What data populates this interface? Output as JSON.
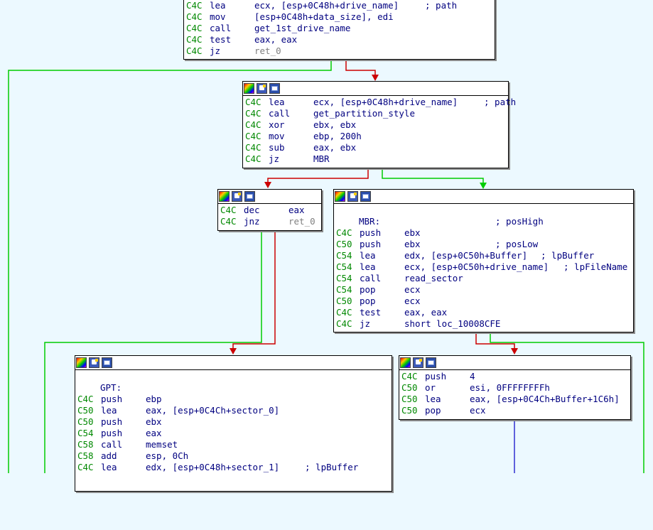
{
  "nodes": {
    "top": {
      "lines": [
        {
          "addr": "C4C",
          "mn": "lea",
          "op": "ecx, [esp+0C48h+drive_name]",
          "cm": "; path"
        },
        {
          "addr": "C4C",
          "mn": "mov",
          "op": "[esp+0C48h+data_size], edi",
          "cm": ""
        },
        {
          "addr": "C4C",
          "mn": "call",
          "op": "get_1st_drive_name",
          "cm": ""
        },
        {
          "addr": "C4C",
          "mn": "test",
          "op": "eax, eax",
          "cm": ""
        },
        {
          "addr": "C4C",
          "mn": "jz",
          "op": "ret_0",
          "cm": ""
        }
      ]
    },
    "partition": {
      "lines": [
        {
          "addr": "C4C",
          "mn": "lea",
          "op": "ecx, [esp+0C48h+drive_name]",
          "cm": "; path"
        },
        {
          "addr": "C4C",
          "mn": "call",
          "op": "get_partition_style",
          "cm": ""
        },
        {
          "addr": "C4C",
          "mn": "xor",
          "op": "ebx, ebx",
          "cm": ""
        },
        {
          "addr": "C4C",
          "mn": "mov",
          "op": "ebp, 200h",
          "cm": ""
        },
        {
          "addr": "C4C",
          "mn": "sub",
          "op": "eax, ebx",
          "cm": ""
        },
        {
          "addr": "C4C",
          "mn": "jz",
          "op": "MBR",
          "cm": ""
        }
      ]
    },
    "dec": {
      "lines": [
        {
          "addr": "C4C",
          "mn": "dec",
          "op": "eax"
        },
        {
          "addr": "C4C",
          "mn": "jnz",
          "op": "ret_0"
        }
      ]
    },
    "mbr": {
      "label": "MBR:",
      "label_comment": "; posHigh",
      "lines": [
        {
          "addr": "C4C",
          "mn": "push",
          "op": "ebx",
          "cm": ""
        },
        {
          "addr": "C50",
          "mn": "push",
          "op": "ebx",
          "cm": "; posLow"
        },
        {
          "addr": "C54",
          "mn": "lea",
          "op": "edx, [esp+0C50h+Buffer]",
          "cm": "; lpBuffer"
        },
        {
          "addr": "C54",
          "mn": "lea",
          "op": "ecx, [esp+0C50h+drive_name]",
          "cm": "; lpFileName"
        },
        {
          "addr": "C54",
          "mn": "call",
          "op": "read_sector",
          "cm": ""
        },
        {
          "addr": "C54",
          "mn": "pop",
          "op": "ecx",
          "cm": ""
        },
        {
          "addr": "C50",
          "mn": "pop",
          "op": "ecx",
          "cm": ""
        },
        {
          "addr": "C4C",
          "mn": "test",
          "op": "eax, eax",
          "cm": ""
        },
        {
          "addr": "C4C",
          "mn": "jz",
          "op": "short loc_10008CFE",
          "cm": ""
        }
      ]
    },
    "gpt": {
      "label": "GPT:",
      "lines": [
        {
          "addr": "C4C",
          "mn": "push",
          "op": "ebp",
          "cm": ""
        },
        {
          "addr": "C50",
          "mn": "lea",
          "op": "eax, [esp+0C4Ch+sector_0]",
          "cm": ""
        },
        {
          "addr": "C50",
          "mn": "push",
          "op": "ebx",
          "cm": ""
        },
        {
          "addr": "C54",
          "mn": "push",
          "op": "eax",
          "cm": ""
        },
        {
          "addr": "C58",
          "mn": "call",
          "op": "memset",
          "cm": ""
        },
        {
          "addr": "C58",
          "mn": "add",
          "op": "esp, 0Ch",
          "cm": ""
        },
        {
          "addr": "C4C",
          "mn": "lea",
          "op": "edx, [esp+0C48h+sector_1]",
          "cm": "; lpBuffer"
        }
      ]
    },
    "pushfour": {
      "lines": [
        {
          "addr": "C4C",
          "mn": "push",
          "op": "4"
        },
        {
          "addr": "C50",
          "mn": "or",
          "op": "esi, 0FFFFFFFFh"
        },
        {
          "addr": "C50",
          "mn": "lea",
          "op": "eax, [esp+0C4Ch+Buffer+1C6h]"
        },
        {
          "addr": "C50",
          "mn": "pop",
          "op": "ecx"
        }
      ]
    }
  },
  "colors": {
    "background": "#ecf9ff",
    "edge_true": "#00cc00",
    "edge_false": "#cc0000",
    "edge_uncond": "#0000cc",
    "address": "#008800",
    "text": "#000080"
  },
  "icons": [
    "color-palette-icon",
    "edit-node-icon",
    "graph-overview-icon"
  ]
}
